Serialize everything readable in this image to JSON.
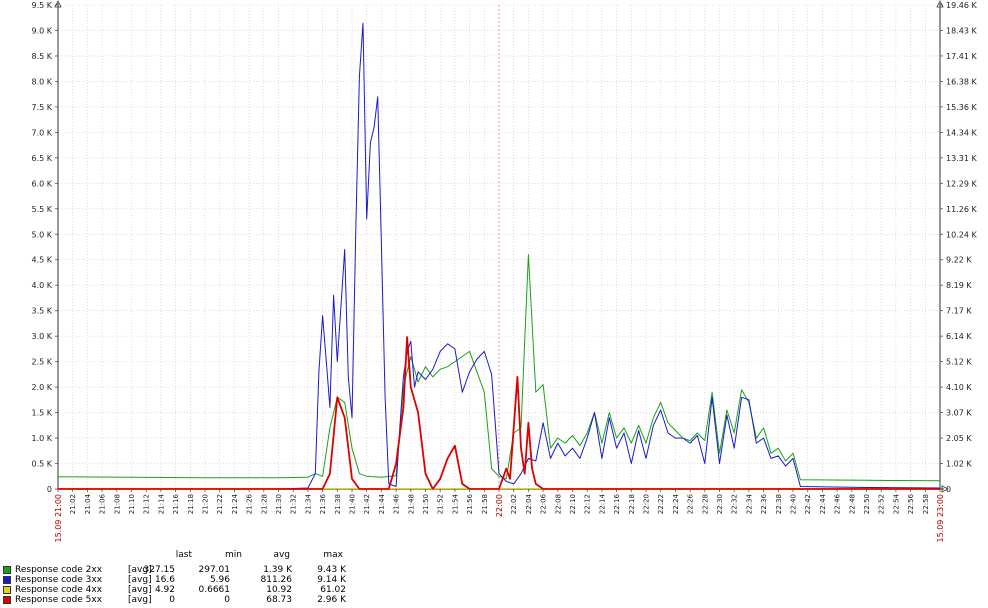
{
  "chart_data": {
    "type": "line",
    "x_start": "21:00",
    "x_end": "23:00",
    "x_step_minutes": 2,
    "x_major_labels": [
      {
        "minute": 0,
        "label": "15.09 21:00"
      },
      {
        "minute": 60,
        "label": "22:00"
      },
      {
        "minute": 120,
        "label": "15.09 23:00"
      }
    ],
    "x_tick_labels": [
      "21:02",
      "21:04",
      "21:06",
      "21:08",
      "21:10",
      "21:12",
      "21:14",
      "21:16",
      "21:18",
      "21:20",
      "21:22",
      "21:24",
      "21:26",
      "21:28",
      "21:30",
      "21:32",
      "21:34",
      "21:36",
      "21:38",
      "21:40",
      "21:42",
      "21:44",
      "21:46",
      "21:48",
      "21:50",
      "21:52",
      "21:54",
      "21:56",
      "21:58",
      "22:02",
      "22:04",
      "22:06",
      "22:08",
      "22:10",
      "22:12",
      "22:14",
      "22:16",
      "22:18",
      "22:20",
      "22:22",
      "22:24",
      "22:26",
      "22:28",
      "22:30",
      "22:32",
      "22:34",
      "22:36",
      "22:38",
      "22:40",
      "22:42",
      "22:44",
      "22:46",
      "22:48",
      "22:50",
      "22:52",
      "22:54",
      "22:56",
      "22:58"
    ],
    "y_left_ticks": [
      "0",
      "0.5 K",
      "1.0 K",
      "1.5 K",
      "2.0 K",
      "2.5 K",
      "3.0 K",
      "3.5 K",
      "4.0 K",
      "4.5 K",
      "5.0 K",
      "5.5 K",
      "6.0 K",
      "6.5 K",
      "7.0 K",
      "7.5 K",
      "8.0 K",
      "8.5 K",
      "9.0 K",
      "9.5 K"
    ],
    "y_right_ticks": [
      "0",
      "1.02 K",
      "2.05 K",
      "3.07 K",
      "4.10 K",
      "5.12 K",
      "6.14 K",
      "7.17 K",
      "8.19 K",
      "9.22 K",
      "10.24 K",
      "11.26 K",
      "12.29 K",
      "13.31 K",
      "14.34 K",
      "15.36 K",
      "16.38 K",
      "17.41 K",
      "18.43 K",
      "19.46 K"
    ],
    "ylim": [
      0,
      9500
    ],
    "grid": true,
    "series": [
      {
        "name": "Response code 2xx",
        "color": "#1aa11a",
        "points": [
          [
            0,
            240
          ],
          [
            10,
            230
          ],
          [
            20,
            220
          ],
          [
            30,
            220
          ],
          [
            34,
            230
          ],
          [
            35,
            300
          ],
          [
            36,
            250
          ],
          [
            37,
            1200
          ],
          [
            38,
            1800
          ],
          [
            39,
            1700
          ],
          [
            40,
            800
          ],
          [
            41,
            300
          ],
          [
            42,
            250
          ],
          [
            44,
            230
          ],
          [
            46,
            260
          ],
          [
            47,
            2000
          ],
          [
            48,
            2600
          ],
          [
            49,
            2100
          ],
          [
            50,
            2400
          ],
          [
            51,
            2200
          ],
          [
            52,
            2350
          ],
          [
            53,
            2400
          ],
          [
            54,
            2500
          ],
          [
            55,
            2600
          ],
          [
            56,
            2700
          ],
          [
            57,
            2300
          ],
          [
            58,
            1900
          ],
          [
            59,
            400
          ],
          [
            60,
            250
          ],
          [
            61,
            200
          ],
          [
            62,
            1100
          ],
          [
            63,
            1200
          ],
          [
            64,
            4600
          ],
          [
            65,
            1900
          ],
          [
            66,
            2050
          ],
          [
            67,
            800
          ],
          [
            68,
            1000
          ],
          [
            69,
            900
          ],
          [
            70,
            1050
          ],
          [
            71,
            850
          ],
          [
            72,
            1100
          ],
          [
            73,
            1500
          ],
          [
            74,
            900
          ],
          [
            75,
            1500
          ],
          [
            76,
            1000
          ],
          [
            77,
            1200
          ],
          [
            78,
            900
          ],
          [
            79,
            1250
          ],
          [
            80,
            900
          ],
          [
            81,
            1400
          ],
          [
            82,
            1700
          ],
          [
            83,
            1300
          ],
          [
            84,
            1150
          ],
          [
            85,
            1000
          ],
          [
            86,
            950
          ],
          [
            87,
            1100
          ],
          [
            88,
            950
          ],
          [
            89,
            1900
          ],
          [
            90,
            700
          ],
          [
            91,
            1550
          ],
          [
            92,
            1100
          ],
          [
            93,
            1950
          ],
          [
            94,
            1700
          ],
          [
            95,
            1000
          ],
          [
            96,
            1200
          ],
          [
            97,
            700
          ],
          [
            98,
            800
          ],
          [
            99,
            550
          ],
          [
            100,
            700
          ],
          [
            101,
            180
          ],
          [
            110,
            170
          ],
          [
            120,
            160
          ]
        ]
      },
      {
        "name": "Response code 3xx",
        "color": "#1a1acc",
        "points": [
          [
            0,
            0
          ],
          [
            10,
            0
          ],
          [
            20,
            0
          ],
          [
            30,
            0
          ],
          [
            34,
            20
          ],
          [
            35,
            300
          ],
          [
            35.5,
            2300
          ],
          [
            36,
            3400
          ],
          [
            36.5,
            2500
          ],
          [
            37,
            1600
          ],
          [
            37.5,
            3800
          ],
          [
            38,
            2500
          ],
          [
            38.5,
            3600
          ],
          [
            39,
            4700
          ],
          [
            39.5,
            2200
          ],
          [
            40,
            1400
          ],
          [
            40.5,
            5000
          ],
          [
            41,
            8100
          ],
          [
            41.5,
            9140
          ],
          [
            42,
            5300
          ],
          [
            42.5,
            6800
          ],
          [
            43,
            7100
          ],
          [
            43.5,
            7700
          ],
          [
            44,
            4800
          ],
          [
            44.5,
            1800
          ],
          [
            45,
            100
          ],
          [
            46,
            50
          ],
          [
            46.5,
            1200
          ],
          [
            47,
            2200
          ],
          [
            47.5,
            2700
          ],
          [
            48,
            2900
          ],
          [
            48.5,
            2000
          ],
          [
            49,
            2300
          ],
          [
            50,
            2150
          ],
          [
            51,
            2350
          ],
          [
            52,
            2700
          ],
          [
            53,
            2850
          ],
          [
            54,
            2750
          ],
          [
            55,
            1900
          ],
          [
            56,
            2300
          ],
          [
            57,
            2550
          ],
          [
            58,
            2700
          ],
          [
            59,
            2250
          ],
          [
            60,
            300
          ],
          [
            61,
            150
          ],
          [
            62,
            100
          ],
          [
            63,
            300
          ],
          [
            64,
            600
          ],
          [
            65,
            550
          ],
          [
            66,
            1300
          ],
          [
            67,
            600
          ],
          [
            68,
            900
          ],
          [
            69,
            650
          ],
          [
            70,
            800
          ],
          [
            71,
            600
          ],
          [
            72,
            1000
          ],
          [
            73,
            1500
          ],
          [
            74,
            600
          ],
          [
            75,
            1400
          ],
          [
            76,
            800
          ],
          [
            77,
            1100
          ],
          [
            78,
            500
          ],
          [
            79,
            1150
          ],
          [
            80,
            600
          ],
          [
            81,
            1250
          ],
          [
            82,
            1550
          ],
          [
            83,
            1100
          ],
          [
            84,
            1000
          ],
          [
            85,
            1000
          ],
          [
            86,
            900
          ],
          [
            87,
            1050
          ],
          [
            88,
            500
          ],
          [
            89,
            1800
          ],
          [
            90,
            500
          ],
          [
            91,
            1450
          ],
          [
            92,
            800
          ],
          [
            93,
            1800
          ],
          [
            94,
            1750
          ],
          [
            95,
            900
          ],
          [
            96,
            1000
          ],
          [
            97,
            600
          ],
          [
            98,
            650
          ],
          [
            99,
            450
          ],
          [
            100,
            600
          ],
          [
            101,
            50
          ],
          [
            110,
            30
          ],
          [
            120,
            20
          ]
        ]
      },
      {
        "name": "Response code 4xx",
        "color": "#e6d600",
        "points": [
          [
            0,
            10
          ],
          [
            30,
            10
          ],
          [
            60,
            10
          ],
          [
            90,
            10
          ],
          [
            120,
            10
          ]
        ]
      },
      {
        "name": "Response code 5xx",
        "color": "#dd0000",
        "points": [
          [
            0,
            0
          ],
          [
            30,
            0
          ],
          [
            36,
            0
          ],
          [
            37,
            300
          ],
          [
            38,
            1800
          ],
          [
            39,
            1400
          ],
          [
            40,
            200
          ],
          [
            41,
            0
          ],
          [
            45,
            0
          ],
          [
            46,
            500
          ],
          [
            47,
            1600
          ],
          [
            47.5,
            2980
          ],
          [
            48,
            2000
          ],
          [
            49,
            1500
          ],
          [
            50,
            300
          ],
          [
            51,
            0
          ],
          [
            52,
            200
          ],
          [
            53,
            600
          ],
          [
            54,
            850
          ],
          [
            55,
            100
          ],
          [
            56,
            0
          ],
          [
            60,
            0
          ],
          [
            61,
            400
          ],
          [
            61.5,
            200
          ],
          [
            62,
            1200
          ],
          [
            62.5,
            2200
          ],
          [
            63,
            800
          ],
          [
            63.5,
            300
          ],
          [
            64,
            1300
          ],
          [
            64.5,
            400
          ],
          [
            65,
            100
          ],
          [
            66,
            0
          ],
          [
            120,
            0
          ]
        ]
      }
    ]
  },
  "legend": {
    "headers": {
      "last": "last",
      "min": "min",
      "avg": "avg",
      "max": "max"
    },
    "rows": [
      {
        "name": "Response code 2xx",
        "func": "[avg]",
        "last": "327.15",
        "min": "297.01",
        "avg": "1.39 K",
        "max": "9.43 K",
        "color": "#1aa11a"
      },
      {
        "name": "Response code 3xx",
        "func": "[avg]",
        "last": "16.6",
        "min": "5.96",
        "avg": "811.26",
        "max": "9.14 K",
        "color": "#1a1acc"
      },
      {
        "name": "Response code 4xx",
        "func": "[avg]",
        "last": "4.92",
        "min": "0.6661",
        "avg": "10.92",
        "max": "61.02",
        "color": "#e6d600"
      },
      {
        "name": "Response code 5xx",
        "func": "[avg]",
        "last": "0",
        "min": "0",
        "avg": "68.73",
        "max": "2.96 K",
        "color": "#dd0000"
      }
    ]
  }
}
